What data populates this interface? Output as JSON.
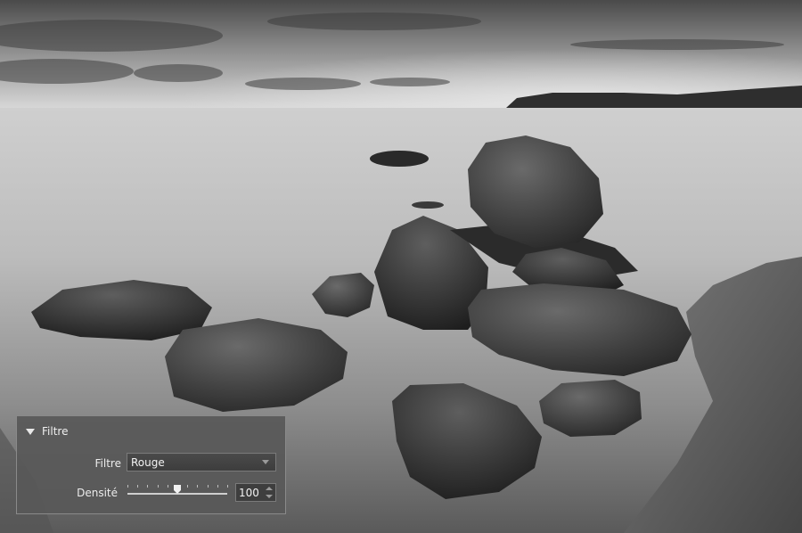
{
  "panel": {
    "title": "Filtre",
    "filter_label": "Filtre",
    "filter_value": "Rouge",
    "density_label": "Densité",
    "density_value": "100",
    "density_slider_level": 0.5
  },
  "colors": {
    "panel_background": "#585858",
    "panel_border": "#8a8a8a",
    "text": "#e6e6e6"
  },
  "icons": {
    "collapse": "triangle-down-icon",
    "dropdown": "chevron-down-icon",
    "spin": "spin-arrows-icon"
  }
}
